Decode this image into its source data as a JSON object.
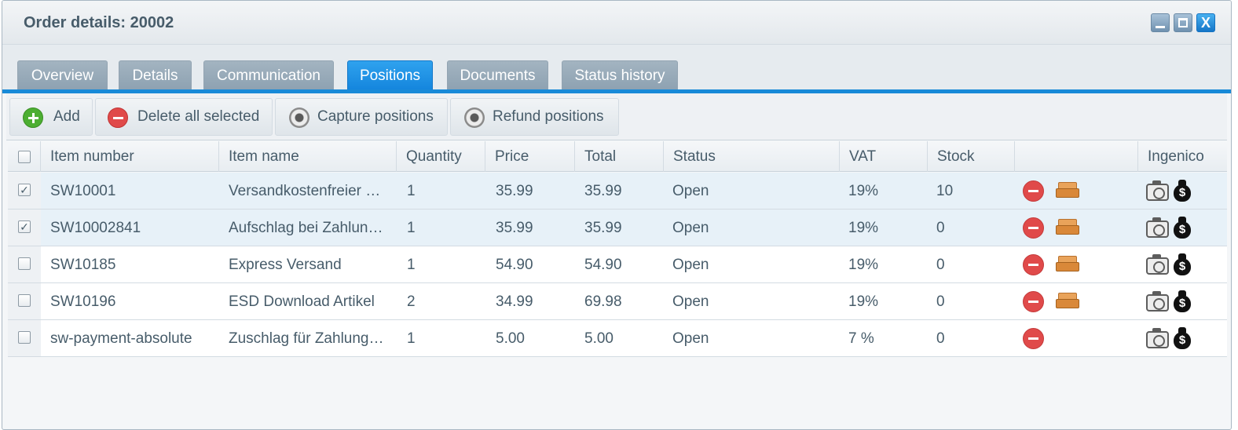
{
  "window": {
    "title": "Order details: 20002",
    "controls": {
      "minimize": "minimize",
      "maximize": "maximize",
      "close": "X"
    }
  },
  "tabs": [
    {
      "label": "Overview",
      "active": false
    },
    {
      "label": "Details",
      "active": false
    },
    {
      "label": "Communication",
      "active": false
    },
    {
      "label": "Positions",
      "active": true
    },
    {
      "label": "Documents",
      "active": false
    },
    {
      "label": "Status history",
      "active": false
    }
  ],
  "toolbar": {
    "add_label": "Add",
    "delete_label": "Delete all selected",
    "capture_label": "Capture positions",
    "refund_label": "Refund positions"
  },
  "grid": {
    "columns": [
      "Item number",
      "Item name",
      "Quantity",
      "Price",
      "Total",
      "Status",
      "VAT",
      "Stock",
      "",
      "Ingenico"
    ],
    "rows": [
      {
        "selected": true,
        "item_number": "SW10001",
        "item_name": "Versandkostenfreier …",
        "quantity": "1",
        "price": "35.99",
        "total": "35.99",
        "status": "Open",
        "vat": "19%",
        "stock": "10",
        "has_stock_action": true
      },
      {
        "selected": true,
        "item_number": "SW10002841",
        "item_name": "Aufschlag bei Zahlun…",
        "quantity": "1",
        "price": "35.99",
        "total": "35.99",
        "status": "Open",
        "vat": "19%",
        "stock": "0",
        "has_stock_action": true
      },
      {
        "selected": false,
        "item_number": "SW10185",
        "item_name": "Express Versand",
        "quantity": "1",
        "price": "54.90",
        "total": "54.90",
        "status": "Open",
        "vat": "19%",
        "stock": "0",
        "has_stock_action": true
      },
      {
        "selected": false,
        "item_number": "SW10196",
        "item_name": "ESD Download Artikel",
        "quantity": "2",
        "price": "34.99",
        "total": "69.98",
        "status": "Open",
        "vat": "19%",
        "stock": "0",
        "has_stock_action": true
      },
      {
        "selected": false,
        "item_number": "sw-payment-absolute",
        "item_name": "Zuschlag für Zahlung…",
        "quantity": "1",
        "price": "5.00",
        "total": "5.00",
        "status": "Open",
        "vat": "7 %",
        "stock": "0",
        "has_stock_action": false
      }
    ]
  },
  "icons": {
    "bag_symbol": "$",
    "check_symbol": "✓"
  },
  "colors": {
    "accent": "#188ad8",
    "active_tab": "#1485dd",
    "inactive_tab": "#8da1b1",
    "delete_red": "#e04a4a",
    "add_green": "#4cae32",
    "selected_row": "#e7f1f8"
  }
}
